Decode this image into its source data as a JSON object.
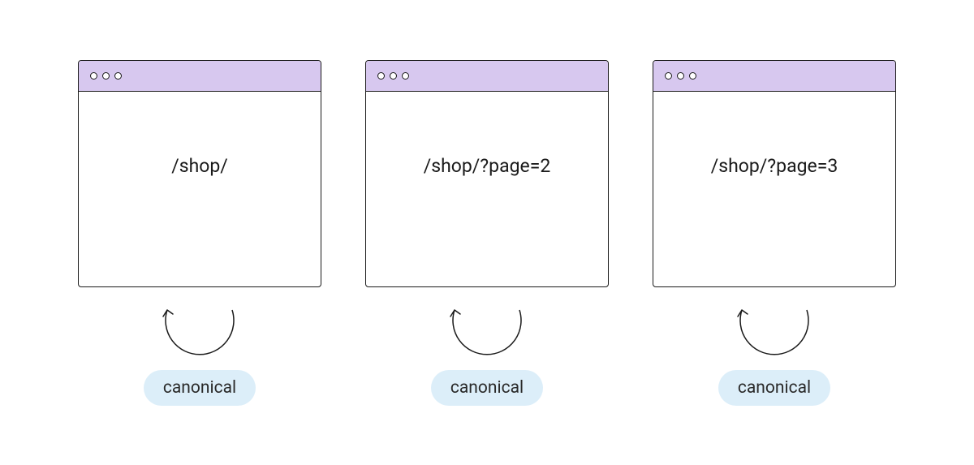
{
  "windows": [
    {
      "url": "/shop/",
      "badge": "canonical"
    },
    {
      "url": "/shop/?page=2",
      "badge": "canonical"
    },
    {
      "url": "/shop/?page=3",
      "badge": "canonical"
    }
  ],
  "colors": {
    "title_bar": "#D7C8EF",
    "badge_bg": "#DCEEF9",
    "border": "#1a1a1a"
  }
}
